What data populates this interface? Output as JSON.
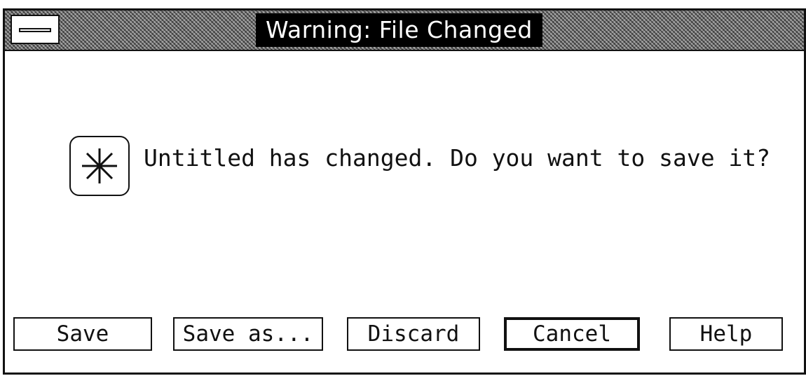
{
  "dialog": {
    "title": "Warning: File Changed",
    "message": "Untitled has changed. Do you want to save it?",
    "icon": "asterisk-icon"
  },
  "buttons": {
    "save": "Save",
    "save_as": "Save as...",
    "discard": "Discard",
    "cancel": "Cancel",
    "help": "Help"
  }
}
